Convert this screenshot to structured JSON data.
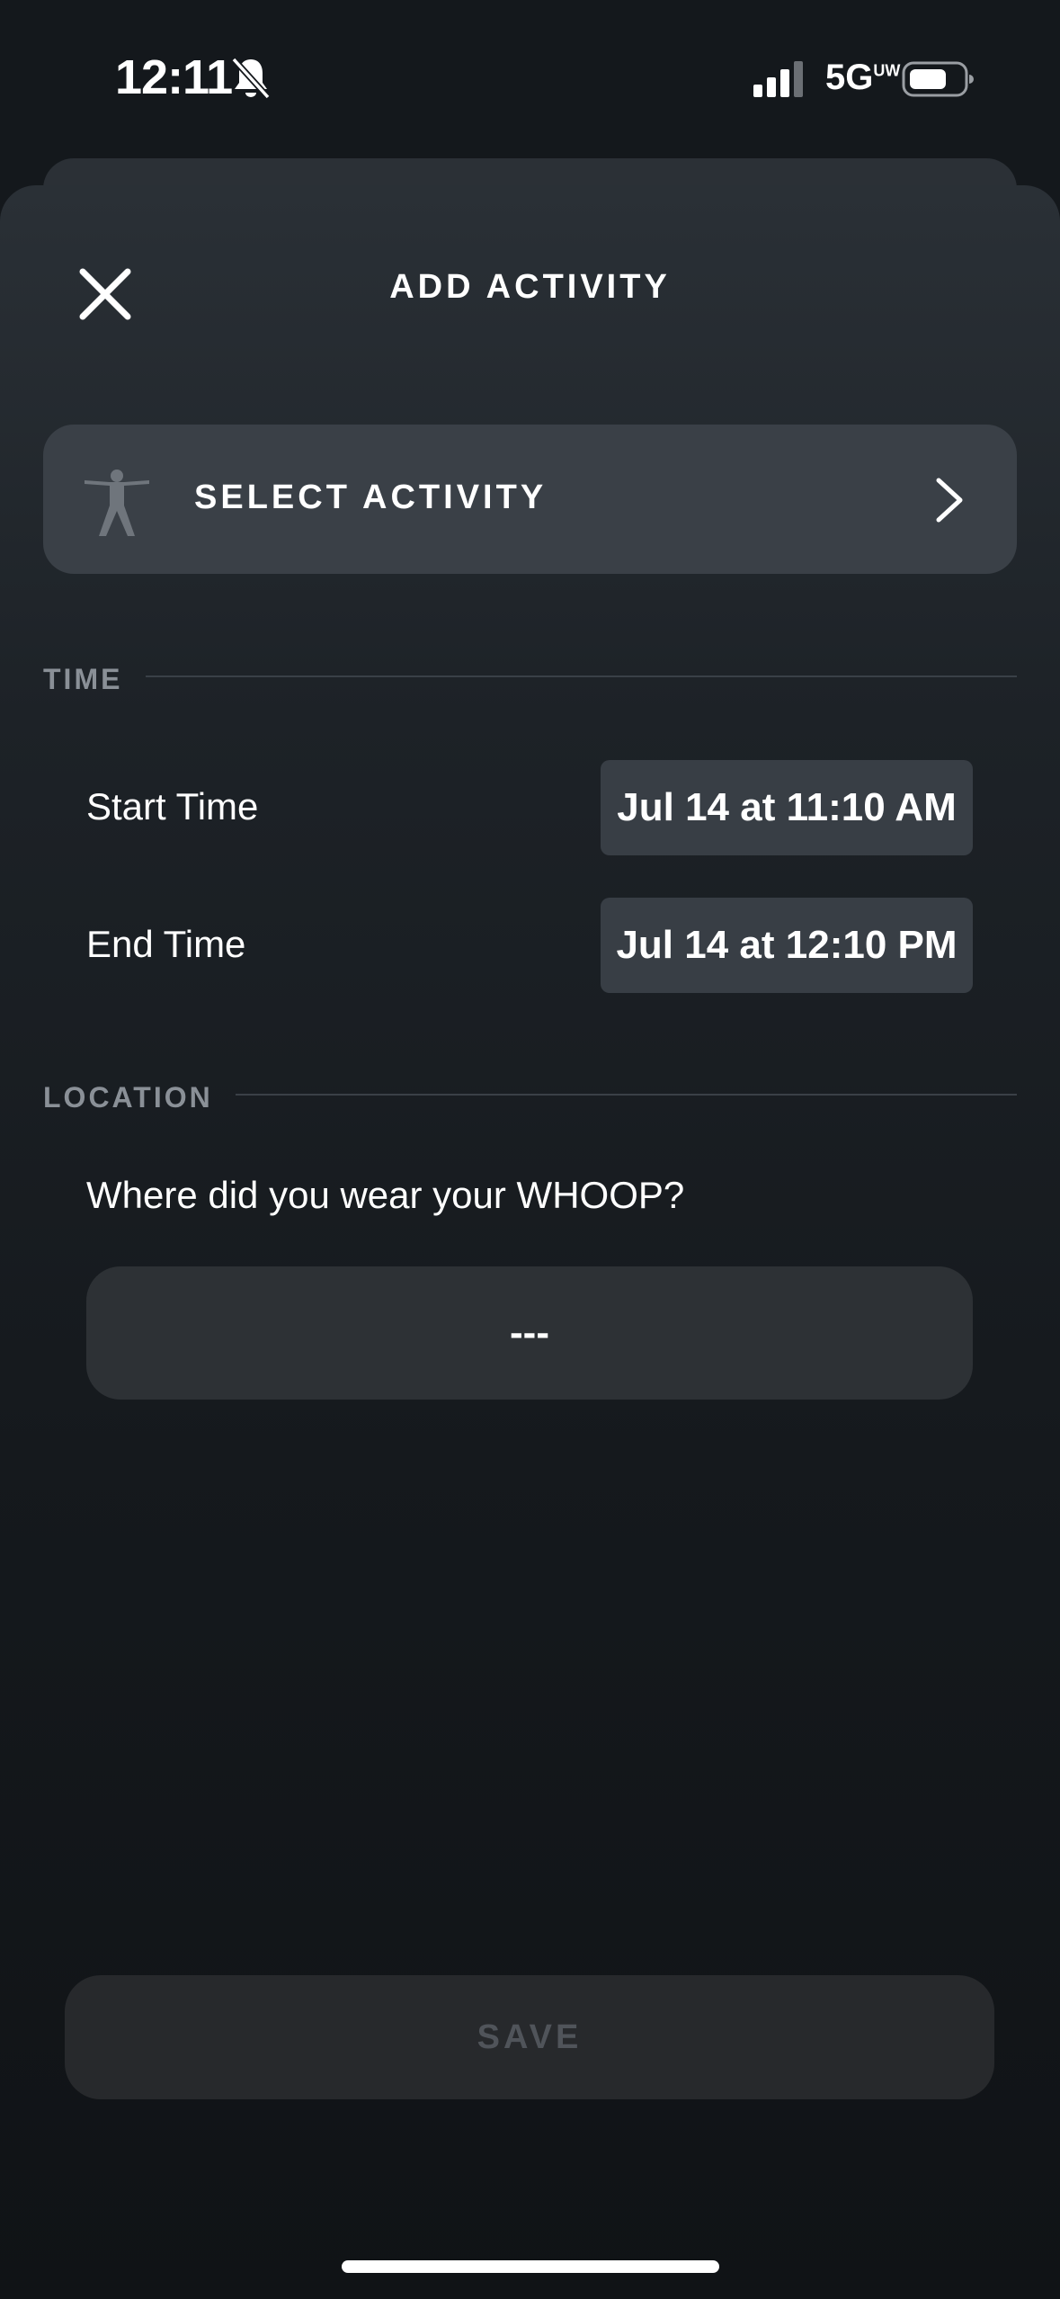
{
  "status_bar": {
    "time": "12:11",
    "network": "5G",
    "network_badge": "UW",
    "icons": [
      "bell-slash-icon",
      "signal-bars-icon",
      "battery-icon"
    ]
  },
  "header": {
    "title": "ADD ACTIVITY",
    "close_icon": "close-icon"
  },
  "activity": {
    "select_label": "SELECT ACTIVITY",
    "icon": "person-figure-icon",
    "chevron_icon": "chevron-right-icon"
  },
  "time_section": {
    "heading": "TIME",
    "start_label": "Start Time",
    "start_value": "Jul 14 at 11:10 AM",
    "end_label": "End Time",
    "end_value": "Jul 14 at 12:10 PM"
  },
  "location_section": {
    "heading": "LOCATION",
    "question": "Where did you wear your WHOOP?",
    "selected_value": "---"
  },
  "footer": {
    "save_label": "SAVE"
  },
  "colors": {
    "background": "#14181c",
    "card": "#3a4047",
    "time_button": "#383e45",
    "save_disabled_text": "#50545a"
  }
}
